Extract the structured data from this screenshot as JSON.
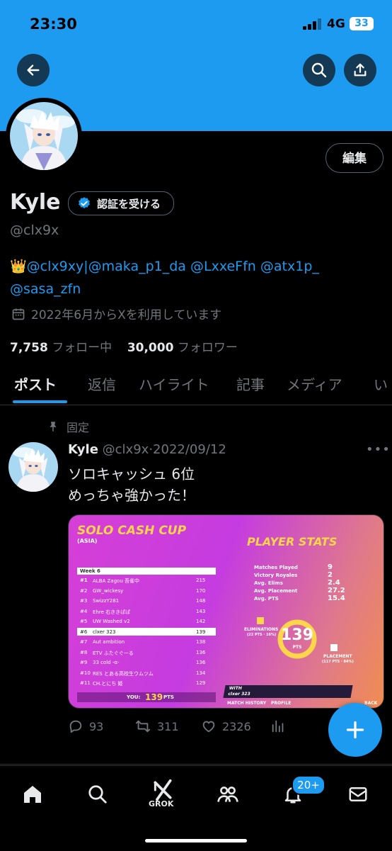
{
  "status_bar": {
    "time": "23:30",
    "network": "4G",
    "battery": "33"
  },
  "profile": {
    "name": "Kyle",
    "verify_label": "認証を受ける",
    "edit_label": "編集",
    "handle": "@clx9x",
    "bio_emoji": "👑",
    "bio_links": [
      "@clx9xy",
      "|",
      "@maka_p1_da",
      "@LxxeFfn",
      "@atx1p_",
      "@sasa_zfn"
    ],
    "joined": "2022年6月からXを利用しています",
    "following_count": "7,758",
    "following_label": "フォロー中",
    "followers_count": "30,000",
    "followers_label": "フォロワー"
  },
  "tabs": [
    "ポスト",
    "返信",
    "ハイライト",
    "記事",
    "メディア",
    "い"
  ],
  "pinned_label": "固定",
  "tweet": {
    "name": "Kyle",
    "handle": "@clx9x",
    "sep": "·",
    "date": "2022/09/12",
    "line1": "ソロキャッシュ 6位",
    "line2": "めっちゃ強かった！",
    "replies": "93",
    "retweets": "311",
    "likes": "2326"
  },
  "media": {
    "title": "SOLO CASH CUP",
    "subtitle": "(ASIA)",
    "stats_title": "PLAYER STATS",
    "week": "Week 6",
    "leaderboard": [
      {
        "rank": "#1",
        "name": "ALBA Zagou 吾雀中",
        "pts": "215"
      },
      {
        "rank": "#2",
        "name": "GW_wickesy",
        "pts": "170"
      },
      {
        "rank": "#3",
        "name": "SwizzY281",
        "pts": "148"
      },
      {
        "rank": "#4",
        "name": "Ehre 右ききぱぱ",
        "pts": "143"
      },
      {
        "rank": "#5",
        "name": "UW Washed v2",
        "pts": "142"
      },
      {
        "rank": "#6",
        "name": "clxer 323",
        "pts": "139"
      },
      {
        "rank": "#7",
        "name": "Aut ambition",
        "pts": "138"
      },
      {
        "rank": "#8",
        "name": "ETV ふたぐぐーる",
        "pts": "136"
      },
      {
        "rank": "#9",
        "name": "33 cold -α-",
        "pts": "136"
      },
      {
        "rank": "#10",
        "name": "RES とある高校生ウムツム",
        "pts": "134"
      },
      {
        "rank": "#11",
        "name": "CH.とにち 姫",
        "pts": "129"
      }
    ],
    "you_label": "YOU:",
    "you_pts": "139",
    "pts_label": "PTS",
    "stats": [
      {
        "label": "Matches Played",
        "value": "9"
      },
      {
        "label": "Victory Royales",
        "value": "2"
      },
      {
        "label": "Avg. Elims",
        "value": "2.4"
      },
      {
        "label": "Avg. Placement",
        "value": "27.2"
      },
      {
        "label": "Avg. PTS",
        "value": "15.4"
      }
    ],
    "total_pts": "139",
    "eliminations_label": "ELIMINATIONS",
    "eliminations_sub": "(22 PTS · 16%)",
    "placement_label": "PLACEMENT",
    "placement_sub": "(117 PTS · 84%)",
    "with_label": "WITH",
    "with_name": "clxer 323",
    "history_label": "MATCH HISTORY",
    "profile_label": "PROFILE",
    "back_label": "BACK"
  },
  "nav": {
    "grok_label": "GROK",
    "notif_badge": "20+"
  },
  "colors": {
    "accent": "#1d9bf0",
    "bg": "#000000",
    "muted": "#71767b"
  }
}
